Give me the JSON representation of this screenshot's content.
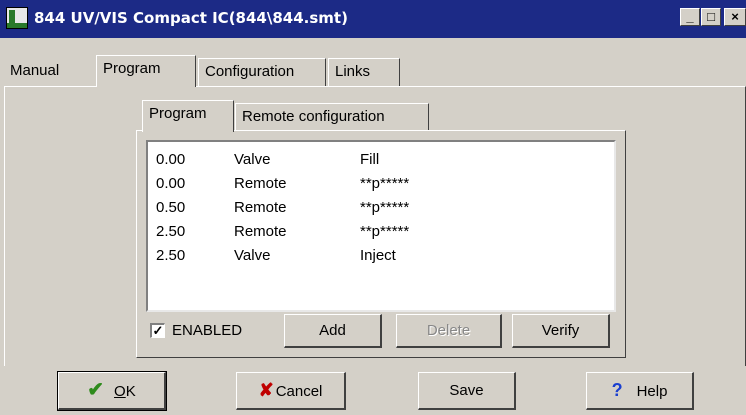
{
  "window": {
    "title": "844 UV/VIS Compact IC(844\\844.smt)",
    "controls": {
      "minimize": "_",
      "maximize": "□",
      "close": "×"
    }
  },
  "main_tabs": [
    {
      "label": "Manual"
    },
    {
      "label": "Program"
    },
    {
      "label": "Configuration"
    },
    {
      "label": "Links"
    }
  ],
  "sub_tabs": [
    {
      "label": "Program"
    },
    {
      "label": "Remote configuration"
    }
  ],
  "program_list": [
    {
      "time": "0.00",
      "device": "Valve",
      "action": "Fill"
    },
    {
      "time": "0.00",
      "device": "Remote",
      "action": "**p*****"
    },
    {
      "time": "0.50",
      "device": "Remote",
      "action": "**p*****"
    },
    {
      "time": "2.50",
      "device": "Remote",
      "action": "**p*****"
    },
    {
      "time": "2.50",
      "device": "Valve",
      "action": "Inject"
    }
  ],
  "enabled": {
    "label": "ENABLED",
    "checked": true,
    "mark": "✓"
  },
  "list_buttons": {
    "add": "Add",
    "delete": "Delete",
    "verify": "Verify"
  },
  "footer": {
    "ok": "OK",
    "cancel": "Cancel",
    "save": "Save",
    "help": "Help"
  },
  "icons": {
    "ok": "check-icon",
    "cancel": "x-icon",
    "help": "question-icon",
    "app": "instrument-icon"
  },
  "colors": {
    "titlebar": "#1c2a86",
    "face": "#d4d0c8",
    "ok_icon": "#2e8b1c",
    "cancel_icon": "#c00000",
    "help_icon": "#1a3fd0"
  }
}
